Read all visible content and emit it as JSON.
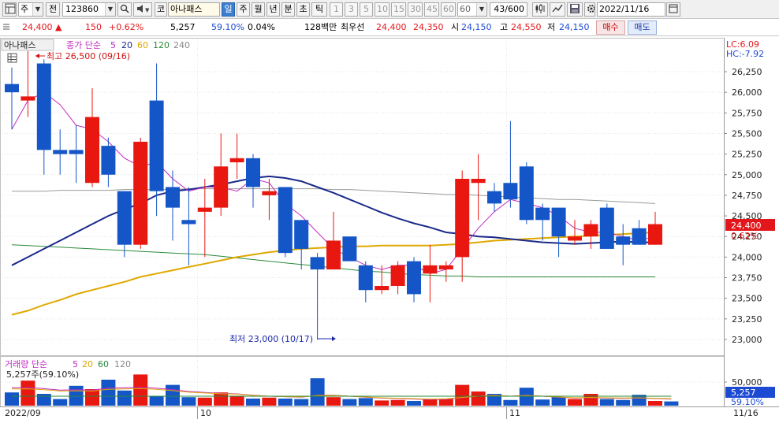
{
  "toolbar": {
    "type_label": "주",
    "type_option": "전",
    "stock_code": "123860",
    "market_label": "코",
    "stock_name": "아나패스",
    "periods": [
      "일",
      "주",
      "월",
      "년",
      "분",
      "초",
      "틱"
    ],
    "active_period": "일",
    "intervals": [
      "1",
      "3",
      "5",
      "10",
      "15",
      "30",
      "45",
      "60"
    ],
    "interval_value": "60",
    "count_value": "43",
    "count_total": "/600",
    "date": "2022/11/16"
  },
  "quote": {
    "price": "24,400",
    "change": "150",
    "change_pct": "+0.62%",
    "volume": "5,257",
    "volume_ratio": "59.10%",
    "turnover": "0.04%",
    "amount": "128백만",
    "best_label": "최우선",
    "best_ask": "24,400",
    "best_bid": "24,350",
    "open_label": "시",
    "open": "24,150",
    "high_label": "고",
    "high": "24,550",
    "low_label": "저",
    "low": "24,150",
    "buy_label": "매수",
    "sell_label": "매도"
  },
  "chart_data": {
    "type": "candlestick",
    "stock_name": "아나패스",
    "price_legend": {
      "prefix": "종가 단순",
      "ma": [
        "5",
        "20",
        "60",
        "120",
        "240"
      ]
    },
    "volume_legend": {
      "prefix": "거래량 단순",
      "ma": [
        "5",
        "20",
        "60",
        "120"
      ],
      "current": "5,257주(59.10%)"
    },
    "lc_label": "LC:6.09",
    "hc_label": "HC:-7.92",
    "high_annotation": "최고 26,500 (09/16)",
    "low_annotation": "최저 23,000 (10/17)",
    "price_ticks": [
      "26,250",
      "26,000",
      "25,750",
      "25,500",
      "25,250",
      "25,000",
      "24,750",
      "24,500",
      "24,250",
      "24,000",
      "23,750",
      "23,500",
      "23,250",
      "23,000"
    ],
    "price_ticks_values": [
      26250,
      26000,
      25750,
      25500,
      25250,
      25000,
      24750,
      24500,
      24250,
      24000,
      23750,
      23500,
      23250,
      23000
    ],
    "volume_ticks": [
      "50,000"
    ],
    "volume_ticks_values": [
      50000
    ],
    "current_price_label": "24,400",
    "current_pct_label": "0.62%",
    "current_volume_label": "5,257",
    "current_volume_pct_label": "59.10%",
    "x_labels": [
      "2022/09",
      "10",
      "11",
      "11/16"
    ],
    "candles": [
      {
        "o": 26100,
        "c": 26000,
        "h": 26300,
        "l": 25550
      },
      {
        "o": 25900,
        "c": 25950,
        "h": 26500,
        "l": 25700
      },
      {
        "o": 26350,
        "c": 25300,
        "h": 26400,
        "l": 25000
      },
      {
        "o": 25300,
        "c": 25250,
        "h": 25550,
        "l": 25000
      },
      {
        "o": 25300,
        "c": 25250,
        "h": 25600,
        "l": 24900
      },
      {
        "o": 24900,
        "c": 25700,
        "h": 26050,
        "l": 24850
      },
      {
        "o": 25350,
        "c": 25000,
        "h": 25450,
        "l": 24850
      },
      {
        "o": 24800,
        "c": 24150,
        "h": 24800,
        "l": 24000
      },
      {
        "o": 24150,
        "c": 25400,
        "h": 25450,
        "l": 24100
      },
      {
        "o": 25900,
        "c": 24800,
        "h": 26350,
        "l": 24500
      },
      {
        "o": 24850,
        "c": 24600,
        "h": 25050,
        "l": 24200
      },
      {
        "o": 24450,
        "c": 24400,
        "h": 24850,
        "l": 23900
      },
      {
        "o": 24550,
        "c": 24600,
        "h": 24950,
        "l": 24000
      },
      {
        "o": 24600,
        "c": 25100,
        "h": 25500,
        "l": 24500
      },
      {
        "o": 25150,
        "c": 25200,
        "h": 25500,
        "l": 24950
      },
      {
        "o": 25200,
        "c": 24850,
        "h": 25250,
        "l": 24600
      },
      {
        "o": 24750,
        "c": 24800,
        "h": 24950,
        "l": 24450
      },
      {
        "o": 24850,
        "c": 24050,
        "h": 24850,
        "l": 24000
      },
      {
        "o": 24450,
        "c": 24100,
        "h": 24450,
        "l": 23850
      },
      {
        "o": 24000,
        "c": 23850,
        "h": 24050,
        "l": 23000
      },
      {
        "o": 23850,
        "c": 24200,
        "h": 24550,
        "l": 23850
      },
      {
        "o": 24250,
        "c": 23950,
        "h": 24250,
        "l": 23950
      },
      {
        "o": 23900,
        "c": 23600,
        "h": 23950,
        "l": 23450
      },
      {
        "o": 23600,
        "c": 23650,
        "h": 23900,
        "l": 23550
      },
      {
        "o": 23650,
        "c": 23900,
        "h": 23950,
        "l": 23550
      },
      {
        "o": 23950,
        "c": 23550,
        "h": 24000,
        "l": 23450
      },
      {
        "o": 23800,
        "c": 23900,
        "h": 24150,
        "l": 23450
      },
      {
        "o": 23850,
        "c": 23900,
        "h": 23950,
        "l": 23700
      },
      {
        "o": 24000,
        "c": 24950,
        "h": 25050,
        "l": 23700
      },
      {
        "o": 24900,
        "c": 24950,
        "h": 25250,
        "l": 24450
      },
      {
        "o": 24800,
        "c": 24650,
        "h": 24900,
        "l": 24550
      },
      {
        "o": 24900,
        "c": 24700,
        "h": 25650,
        "l": 24600
      },
      {
        "o": 25100,
        "c": 24450,
        "h": 25150,
        "l": 24400
      },
      {
        "o": 24600,
        "c": 24450,
        "h": 24650,
        "l": 24200
      },
      {
        "o": 24600,
        "c": 24250,
        "h": 24600,
        "l": 24000
      },
      {
        "o": 24200,
        "c": 24250,
        "h": 24450,
        "l": 24150
      },
      {
        "o": 24250,
        "c": 24400,
        "h": 24450,
        "l": 24100
      },
      {
        "o": 24600,
        "c": 24100,
        "h": 24650,
        "l": 24100
      },
      {
        "o": 24250,
        "c": 24150,
        "h": 24400,
        "l": 23900
      },
      {
        "o": 24350,
        "c": 24150,
        "h": 24450,
        "l": 24150
      },
      {
        "o": 24150,
        "c": 24400,
        "h": 24550,
        "l": 24150
      }
    ],
    "ma5": [
      25550,
      25900,
      26000,
      25850,
      25600,
      25550,
      25400,
      25200,
      25100,
      25150,
      24950,
      24800,
      24850,
      24850,
      24800,
      24950,
      24900,
      24650,
      24500,
      24300,
      24100,
      24000,
      23900,
      23850,
      23900,
      23900,
      23800,
      23850,
      24100,
      24350,
      24550,
      24700,
      24650,
      24600,
      24500,
      24350,
      24300,
      24300,
      24250,
      24200,
      24250
    ],
    "ma20": [
      23900,
      24000,
      24100,
      24200,
      24300,
      24400,
      24500,
      24580,
      24650,
      24750,
      24800,
      24820,
      24850,
      24880,
      24920,
      24960,
      24980,
      24960,
      24920,
      24850,
      24780,
      24700,
      24620,
      24540,
      24470,
      24410,
      24360,
      24300,
      24280,
      24250,
      24240,
      24220,
      24200,
      24180,
      24170,
      24160,
      24170,
      24180,
      24190,
      24180,
      24180
    ],
    "ma60": [
      23300,
      23350,
      23420,
      23480,
      23550,
      23600,
      23650,
      23700,
      23760,
      23800,
      23840,
      23880,
      23920,
      23960,
      24000,
      24030,
      24060,
      24080,
      24100,
      24110,
      24120,
      24130,
      24130,
      24140,
      24140,
      24140,
      24140,
      24150,
      24160,
      24180,
      24200,
      24210,
      24220,
      24230,
      24240,
      24250,
      24260,
      24270,
      24280,
      24290,
      24300
    ],
    "ma120": [
      24150,
      24140,
      24130,
      24120,
      24110,
      24100,
      24090,
      24080,
      24070,
      24060,
      24050,
      24040,
      24030,
      24010,
      23990,
      23970,
      23950,
      23930,
      23910,
      23890,
      23870,
      23850,
      23830,
      23820,
      23800,
      23790,
      23780,
      23770,
      23770,
      23760,
      23760,
      23760,
      23760,
      23760,
      23760,
      23760,
      23760,
      23760,
      23760,
      23760,
      23760
    ],
    "ma240": [
      24800,
      24800,
      24800,
      24810,
      24810,
      24810,
      24810,
      24820,
      24820,
      24820,
      24820,
      24830,
      24830,
      24830,
      24830,
      24830,
      24830,
      24830,
      24830,
      24830,
      24820,
      24820,
      24810,
      24800,
      24790,
      24780,
      24770,
      24760,
      24760,
      24750,
      24740,
      24730,
      24720,
      24710,
      24700,
      24700,
      24690,
      24680,
      24670,
      24660,
      24650
    ],
    "volumes": [
      28000,
      53000,
      25000,
      14000,
      42000,
      35000,
      55000,
      32000,
      66000,
      20000,
      44000,
      18000,
      17000,
      28000,
      21000,
      15000,
      17000,
      15000,
      14000,
      58000,
      18000,
      14000,
      16000,
      11000,
      12000,
      10000,
      13000,
      14000,
      44000,
      30000,
      25000,
      12000,
      38000,
      13000,
      18000,
      14000,
      25000,
      14000,
      12000,
      23000,
      10000,
      9000
    ],
    "vol_ma": [
      38000,
      38500,
      36000,
      33000,
      33500,
      33000,
      37000,
      38000,
      39000,
      37000,
      34000,
      30000,
      28000,
      26000,
      25000,
      22000,
      20000,
      19000,
      18000,
      22000,
      22000,
      20000,
      18000,
      16000,
      15000,
      14000,
      13000,
      13500,
      17000,
      20000,
      22000,
      20000,
      22000,
      20000,
      18000,
      16000,
      17000,
      16000,
      15500,
      16000,
      15000,
      14000
    ]
  }
}
